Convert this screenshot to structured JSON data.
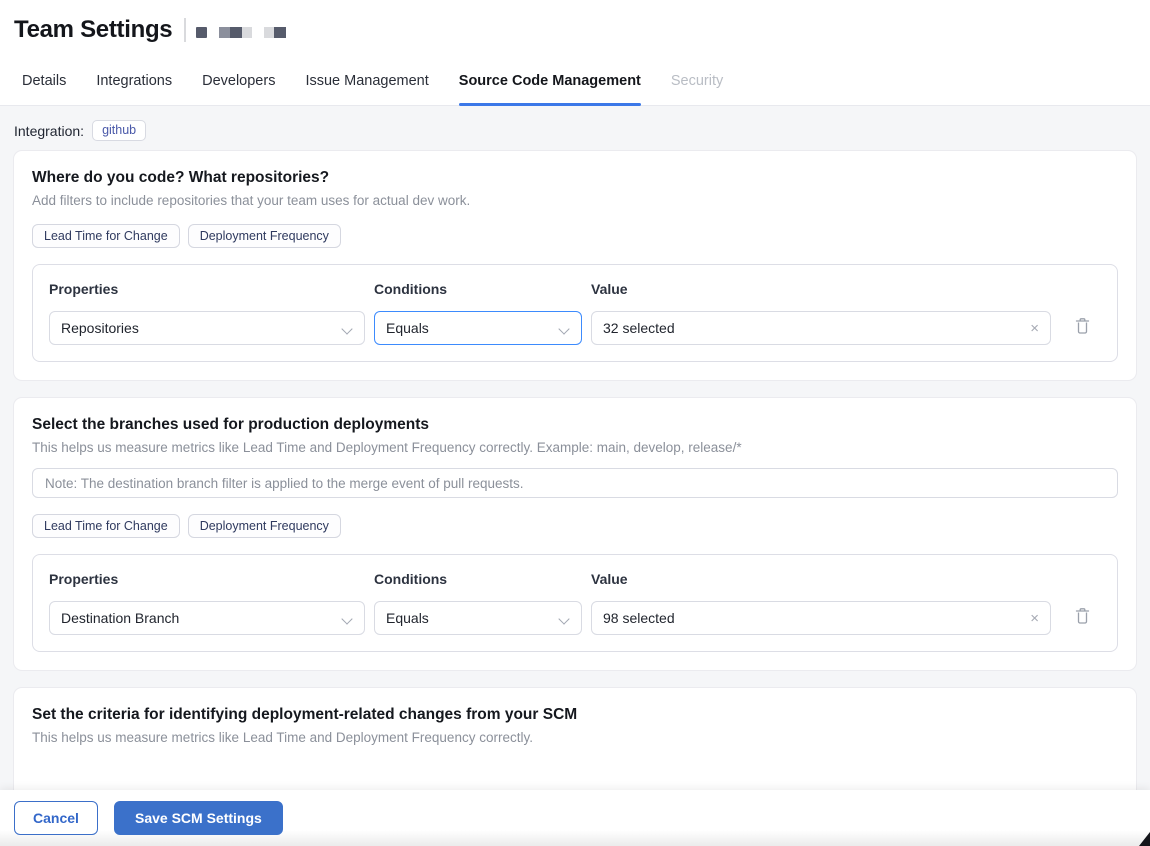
{
  "header": {
    "title": "Team Settings"
  },
  "tabs": [
    {
      "label": "Details"
    },
    {
      "label": "Integrations"
    },
    {
      "label": "Developers"
    },
    {
      "label": "Issue Management"
    },
    {
      "label": "Source Code Management"
    },
    {
      "label": "Security"
    }
  ],
  "integration": {
    "label": "Integration:",
    "badge": "github"
  },
  "sections": [
    {
      "title": "Where do you code? What repositories?",
      "description": "Add filters to include repositories that your team uses for actual dev work.",
      "metric_badges": [
        "Lead Time for Change",
        "Deployment Frequency"
      ],
      "filter": {
        "properties_label": "Properties",
        "conditions_label": "Conditions",
        "value_label": "Value",
        "property": "Repositories",
        "condition": "Equals",
        "value": "32 selected",
        "clear_icon": "×"
      }
    },
    {
      "title": "Select the branches used for production deployments",
      "description": "This helps us measure metrics like Lead Time and Deployment Frequency correctly. Example: main, develop, release/*",
      "note_placeholder": "Note: The destination branch filter is applied to the merge event of pull requests.",
      "metric_badges": [
        "Lead Time for Change",
        "Deployment Frequency"
      ],
      "filter": {
        "properties_label": "Properties",
        "conditions_label": "Conditions",
        "value_label": "Value",
        "property": "Destination Branch",
        "condition": "Equals",
        "value": "98 selected",
        "clear_icon": "×"
      }
    },
    {
      "title": "Set the criteria for identifying deployment-related changes from your SCM",
      "description": "This helps us measure metrics like Lead Time and Deployment Frequency correctly."
    }
  ],
  "footer": {
    "cancel_label": "Cancel",
    "save_label": "Save SCM Settings"
  },
  "colors": {
    "accent_blue": "#3b78e8",
    "focus_blue": "#3d8bfd",
    "button_blue": "#3b71ca",
    "badge_text": "#2f3a5f",
    "page_bg": "#f5f6f8"
  }
}
